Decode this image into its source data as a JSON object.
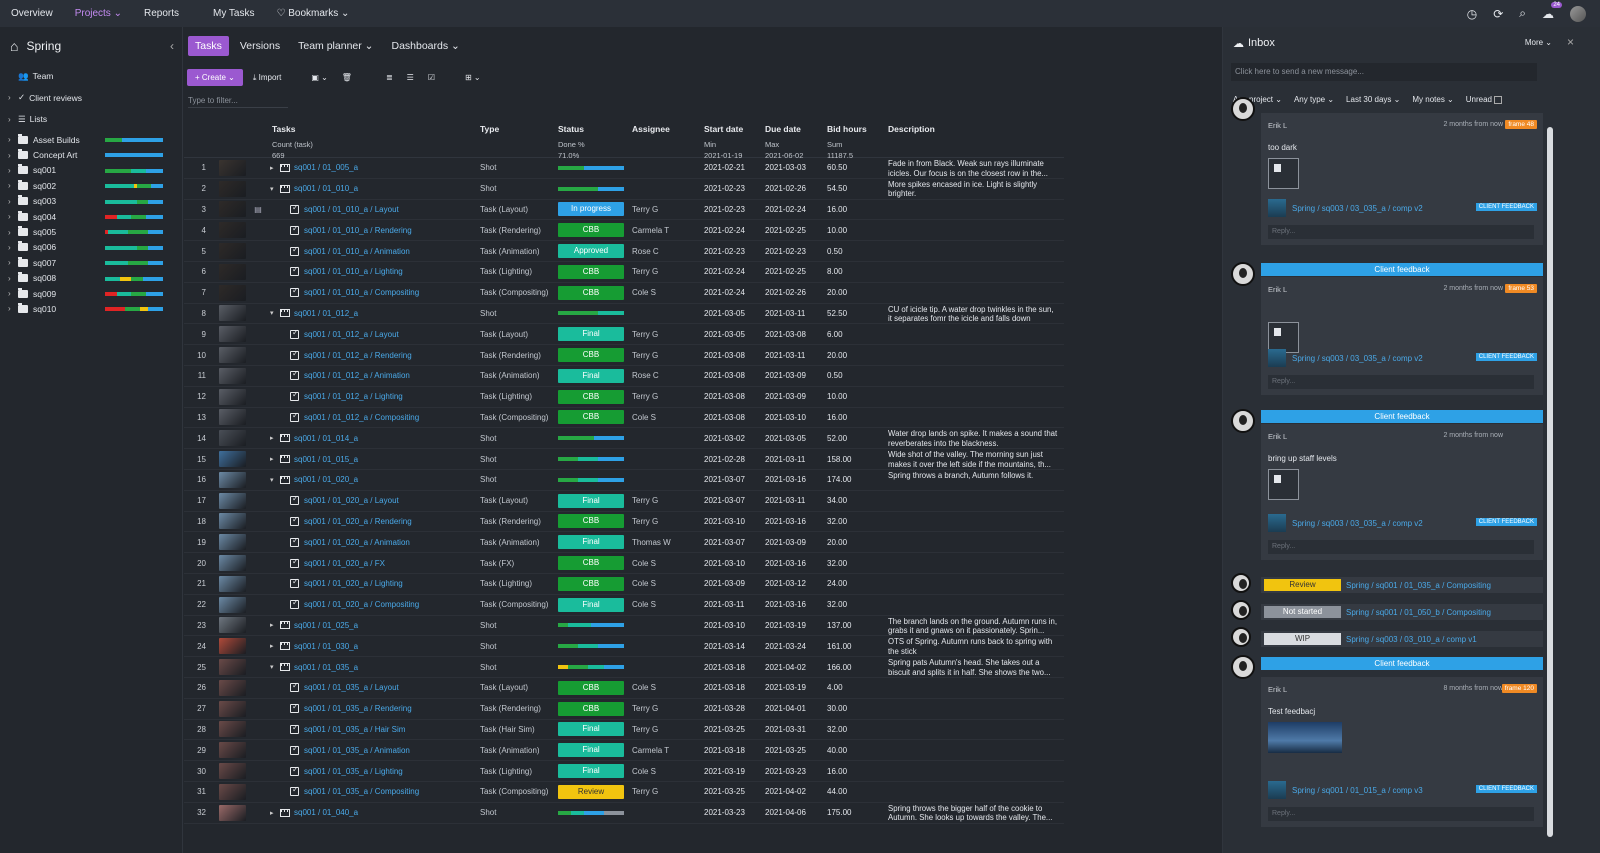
{
  "topnav": {
    "items": [
      "Overview",
      "Projects",
      "Reports",
      "My Tasks",
      "Bookmarks"
    ],
    "notifications_count": "24"
  },
  "sidebar": {
    "project": "Spring",
    "team": "Team",
    "client_reviews": "Client reviews",
    "lists": "Lists",
    "folders": [
      {
        "name": "Asset Builds",
        "bar": [
          [
            "#27a844",
            0.3
          ],
          [
            "#2ea1e6",
            0.7
          ]
        ]
      },
      {
        "name": "Concept Art",
        "bar": [
          [
            "#2ea1e6",
            1.0
          ]
        ]
      },
      {
        "name": "sq001",
        "bar": [
          [
            "#27a844",
            0.45
          ],
          [
            "#1abc9c",
            0.25
          ],
          [
            "#2ea1e6",
            0.3
          ]
        ]
      },
      {
        "name": "sq002",
        "bar": [
          [
            "#1abc9c",
            0.5
          ],
          [
            "#f1c40f",
            0.05
          ],
          [
            "#27a844",
            0.25
          ],
          [
            "#2ea1e6",
            0.2
          ]
        ]
      },
      {
        "name": "sq003",
        "bar": [
          [
            "#1abc9c",
            0.55
          ],
          [
            "#27a844",
            0.2
          ],
          [
            "#2ea1e6",
            0.25
          ]
        ]
      },
      {
        "name": "sq004",
        "bar": [
          [
            "#e02424",
            0.2
          ],
          [
            "#1abc9c",
            0.25
          ],
          [
            "#27a844",
            0.25
          ],
          [
            "#2ea1e6",
            0.3
          ]
        ]
      },
      {
        "name": "sq005",
        "bar": [
          [
            "#e02424",
            0.05
          ],
          [
            "#1abc9c",
            0.35
          ],
          [
            "#27a844",
            0.35
          ],
          [
            "#2ea1e6",
            0.25
          ]
        ]
      },
      {
        "name": "sq006",
        "bar": [
          [
            "#1abc9c",
            0.55
          ],
          [
            "#27a844",
            0.2
          ],
          [
            "#2ea1e6",
            0.25
          ]
        ]
      },
      {
        "name": "sq007",
        "bar": [
          [
            "#1abc9c",
            0.4
          ],
          [
            "#27a844",
            0.35
          ],
          [
            "#2ea1e6",
            0.25
          ]
        ]
      },
      {
        "name": "sq008",
        "bar": [
          [
            "#1abc9c",
            0.25
          ],
          [
            "#f1c40f",
            0.2
          ],
          [
            "#27a844",
            0.2
          ],
          [
            "#2ea1e6",
            0.35
          ]
        ]
      },
      {
        "name": "sq009",
        "bar": [
          [
            "#e02424",
            0.2
          ],
          [
            "#1abc9c",
            0.25
          ],
          [
            "#27a844",
            0.25
          ],
          [
            "#2ea1e6",
            0.3
          ]
        ]
      },
      {
        "name": "sq010",
        "bar": [
          [
            "#e02424",
            0.35
          ],
          [
            "#27a844",
            0.25
          ],
          [
            "#f1c40f",
            0.15
          ],
          [
            "#2ea1e6",
            0.25
          ]
        ]
      }
    ]
  },
  "tabs": [
    "Tasks",
    "Versions",
    "Team planner",
    "Dashboards"
  ],
  "toolbar": {
    "create": "Create",
    "import": "Import",
    "filter_placeholder": "Type to filter..."
  },
  "grid": {
    "headers": {
      "tasks": "Tasks",
      "type": "Type",
      "status": "Status",
      "assignee": "Assignee",
      "start": "Start date",
      "due": "Due date",
      "bid": "Bid hours",
      "desc": "Description"
    },
    "summary": {
      "tasks_label": "Count (task)",
      "tasks_value": "669",
      "status_label": "Done %",
      "status_value": "71.0%",
      "start_label": "Min",
      "start_value": "2021-01-19",
      "due_label": "Max",
      "due_value": "2021-06-02",
      "bid_label": "Sum",
      "bid_value": "11187.5"
    },
    "rows": [
      {
        "n": "1",
        "kind": "shot",
        "exp": "▸",
        "name": "sq001 / 01_005_a",
        "type": "Shot",
        "prog": [
          [
            "#27a844",
            0.4
          ],
          [
            "#2ea1e6",
            0.6
          ]
        ],
        "start": "2021-02-21",
        "due": "2021-03-03",
        "bid": "60.50",
        "desc": "Fade in from Black. Weak sun rays illuminate icicles. Our focus is on the closest row in the...",
        "thumb": "#3a3430"
      },
      {
        "n": "2",
        "kind": "shot",
        "exp": "▾",
        "name": "sq001 / 01_010_a",
        "type": "Shot",
        "prog": [
          [
            "#27a844",
            0.6
          ],
          [
            "#2ea1e6",
            0.4
          ]
        ],
        "start": "2021-02-23",
        "due": "2021-02-26",
        "bid": "54.50",
        "desc": "More spikes encased in ice. Light is slightly brighter.",
        "thumb": "#2e2a28"
      },
      {
        "n": "3",
        "kind": "task",
        "name": "sq001 / 01_010_a / Layout",
        "type": "Task (Layout)",
        "status": "In progress",
        "scolor": "#2ea1e6",
        "assignee": "Terry G",
        "start": "2021-02-23",
        "due": "2021-02-24",
        "bid": "16.00",
        "desc": "",
        "thumb": "#2e2a28",
        "cmt": "▣"
      },
      {
        "n": "4",
        "kind": "task",
        "name": "sq001 / 01_010_a / Rendering",
        "type": "Task (Rendering)",
        "status": "CBB",
        "scolor": "#169c33",
        "assignee": "Carmela T",
        "start": "2021-02-24",
        "due": "2021-02-25",
        "bid": "10.00",
        "desc": "",
        "thumb": "#2e2a28"
      },
      {
        "n": "5",
        "kind": "task",
        "name": "sq001 / 01_010_a / Animation",
        "type": "Task (Animation)",
        "status": "Approved",
        "scolor": "#1abc9c",
        "assignee": "Rose C",
        "start": "2021-02-23",
        "due": "2021-02-23",
        "bid": "0.50",
        "desc": "",
        "thumb": "#2e2a28"
      },
      {
        "n": "6",
        "kind": "task",
        "name": "sq001 / 01_010_a / Lighting",
        "type": "Task (Lighting)",
        "status": "CBB",
        "scolor": "#169c33",
        "assignee": "Terry G",
        "start": "2021-02-24",
        "due": "2021-02-25",
        "bid": "8.00",
        "desc": "",
        "thumb": "#2e2a28"
      },
      {
        "n": "7",
        "kind": "task",
        "name": "sq001 / 01_010_a / Compositing",
        "type": "Task (Compositing)",
        "status": "CBB",
        "scolor": "#169c33",
        "assignee": "Cole S",
        "start": "2021-02-24",
        "due": "2021-02-26",
        "bid": "20.00",
        "desc": "",
        "thumb": "#2e2a28"
      },
      {
        "n": "8",
        "kind": "shot",
        "exp": "▾",
        "name": "sq001 / 01_012_a",
        "type": "Shot",
        "prog": [
          [
            "#27a844",
            0.6
          ],
          [
            "#1abc9c",
            0.4
          ]
        ],
        "start": "2021-03-05",
        "due": "2021-03-11",
        "bid": "52.50",
        "desc": "CU of icicle tip. A water drop twinkles in the sun, it separates fomr the icicle and falls down",
        "thumb": "#5a5e66"
      },
      {
        "n": "9",
        "kind": "task",
        "name": "sq001 / 01_012_a / Layout",
        "type": "Task (Layout)",
        "status": "Final",
        "scolor": "#1abc9c",
        "assignee": "Terry G",
        "start": "2021-03-05",
        "due": "2021-03-08",
        "bid": "6.00",
        "desc": "",
        "thumb": "#5a5e66"
      },
      {
        "n": "10",
        "kind": "task",
        "name": "sq001 / 01_012_a / Rendering",
        "type": "Task (Rendering)",
        "status": "CBB",
        "scolor": "#169c33",
        "assignee": "Terry G",
        "start": "2021-03-08",
        "due": "2021-03-11",
        "bid": "20.00",
        "desc": "",
        "thumb": "#5a5e66"
      },
      {
        "n": "11",
        "kind": "task",
        "name": "sq001 / 01_012_a / Animation",
        "type": "Task (Animation)",
        "status": "Final",
        "scolor": "#1abc9c",
        "assignee": "Rose C",
        "start": "2021-03-08",
        "due": "2021-03-09",
        "bid": "0.50",
        "desc": "",
        "thumb": "#5a5e66"
      },
      {
        "n": "12",
        "kind": "task",
        "name": "sq001 / 01_012_a / Lighting",
        "type": "Task (Lighting)",
        "status": "CBB",
        "scolor": "#169c33",
        "assignee": "Terry G",
        "start": "2021-03-08",
        "due": "2021-03-09",
        "bid": "10.00",
        "desc": "",
        "thumb": "#5a5e66"
      },
      {
        "n": "13",
        "kind": "task",
        "name": "sq001 / 01_012_a / Compositing",
        "type": "Task (Compositing)",
        "status": "CBB",
        "scolor": "#169c33",
        "assignee": "Cole S",
        "start": "2021-03-08",
        "due": "2021-03-10",
        "bid": "16.00",
        "desc": "",
        "thumb": "#5a5e66"
      },
      {
        "n": "14",
        "kind": "shot",
        "exp": "▸",
        "name": "sq001 / 01_014_a",
        "type": "Shot",
        "prog": [
          [
            "#27a844",
            0.55
          ],
          [
            "#2ea1e6",
            0.45
          ]
        ],
        "start": "2021-03-02",
        "due": "2021-03-05",
        "bid": "52.00",
        "desc": "Water drop lands on spike. It makes a sound that reverberates into the blackness.",
        "thumb": "#4a4f57"
      },
      {
        "n": "15",
        "kind": "shot",
        "exp": "▸",
        "name": "sq001 / 01_015_a",
        "type": "Shot",
        "prog": [
          [
            "#27a844",
            0.3
          ],
          [
            "#1abc9c",
            0.3
          ],
          [
            "#2ea1e6",
            0.4
          ]
        ],
        "start": "2021-02-28",
        "due": "2021-03-11",
        "bid": "158.00",
        "desc": "Wide shot of the valley. The morning sun just makes it over the left side if the mountains, th...",
        "thumb": "#3f6f9c"
      },
      {
        "n": "16",
        "kind": "shot",
        "exp": "▾",
        "name": "sq001 / 01_020_a",
        "type": "Shot",
        "prog": [
          [
            "#27a844",
            0.3
          ],
          [
            "#1abc9c",
            0.3
          ],
          [
            "#2ea1e6",
            0.4
          ]
        ],
        "start": "2021-03-07",
        "due": "2021-03-16",
        "bid": "174.00",
        "desc": "Spring throws a branch, Autumn follows it.",
        "thumb": "#6c8aa5"
      },
      {
        "n": "17",
        "kind": "task",
        "name": "sq001 / 01_020_a / Layout",
        "type": "Task (Layout)",
        "status": "Final",
        "scolor": "#1abc9c",
        "assignee": "Terry G",
        "start": "2021-03-07",
        "due": "2021-03-11",
        "bid": "34.00",
        "desc": "",
        "thumb": "#6c8aa5"
      },
      {
        "n": "18",
        "kind": "task",
        "name": "sq001 / 01_020_a / Rendering",
        "type": "Task (Rendering)",
        "status": "CBB",
        "scolor": "#169c33",
        "assignee": "Terry G",
        "start": "2021-03-10",
        "due": "2021-03-16",
        "bid": "32.00",
        "desc": "",
        "thumb": "#6c8aa5"
      },
      {
        "n": "19",
        "kind": "task",
        "name": "sq001 / 01_020_a / Animation",
        "type": "Task (Animation)",
        "status": "Final",
        "scolor": "#1abc9c",
        "assignee": "Thomas W",
        "start": "2021-03-07",
        "due": "2021-03-09",
        "bid": "20.00",
        "desc": "",
        "thumb": "#6c8aa5"
      },
      {
        "n": "20",
        "kind": "task",
        "name": "sq001 / 01_020_a / FX",
        "type": "Task (FX)",
        "status": "CBB",
        "scolor": "#169c33",
        "assignee": "Cole S",
        "start": "2021-03-10",
        "due": "2021-03-16",
        "bid": "32.00",
        "desc": "",
        "thumb": "#6c8aa5"
      },
      {
        "n": "21",
        "kind": "task",
        "name": "sq001 / 01_020_a / Lighting",
        "type": "Task (Lighting)",
        "status": "CBB",
        "scolor": "#169c33",
        "assignee": "Cole S",
        "start": "2021-03-09",
        "due": "2021-03-12",
        "bid": "24.00",
        "desc": "",
        "thumb": "#6c8aa5"
      },
      {
        "n": "22",
        "kind": "task",
        "name": "sq001 / 01_020_a / Compositing",
        "type": "Task (Compositing)",
        "status": "Final",
        "scolor": "#1abc9c",
        "assignee": "Cole S",
        "start": "2021-03-11",
        "due": "2021-03-16",
        "bid": "32.00",
        "desc": "",
        "thumb": "#6c8aa5"
      },
      {
        "n": "23",
        "kind": "shot",
        "exp": "▸",
        "name": "sq001 / 01_025_a",
        "type": "Shot",
        "prog": [
          [
            "#27a844",
            0.15
          ],
          [
            "#1abc9c",
            0.35
          ],
          [
            "#2ea1e6",
            0.5
          ]
        ],
        "start": "2021-03-10",
        "due": "2021-03-19",
        "bid": "137.00",
        "desc": "The branch lands on the ground. Autumn runs in, grabs it and gnaws on it passionately. Sprin...",
        "thumb": "#6f7780"
      },
      {
        "n": "24",
        "kind": "shot",
        "exp": "▸",
        "name": "sq001 / 01_030_a",
        "type": "Shot",
        "prog": [
          [
            "#27a844",
            0.3
          ],
          [
            "#1abc9c",
            0.3
          ],
          [
            "#2ea1e6",
            0.4
          ]
        ],
        "start": "2021-03-14",
        "due": "2021-03-24",
        "bid": "161.00",
        "desc": "OTS of Spring. Autumn runs back to spring with the stick",
        "thumb": "#b04a3a"
      },
      {
        "n": "25",
        "kind": "shot",
        "exp": "▾",
        "name": "sq001 / 01_035_a",
        "type": "Shot",
        "prog": [
          [
            "#f1c40f",
            0.15
          ],
          [
            "#27a844",
            0.3
          ],
          [
            "#1abc9c",
            0.25
          ],
          [
            "#2ea1e6",
            0.3
          ]
        ],
        "start": "2021-03-18",
        "due": "2021-04-02",
        "bid": "166.00",
        "desc": "Spring pats Autumn's head. She takes out a biscuit and splits it in half. She shows the two...",
        "thumb": "#6a4a48"
      },
      {
        "n": "26",
        "kind": "task",
        "name": "sq001 / 01_035_a / Layout",
        "type": "Task (Layout)",
        "status": "CBB",
        "scolor": "#169c33",
        "assignee": "Cole S",
        "start": "2021-03-18",
        "due": "2021-03-19",
        "bid": "4.00",
        "desc": "",
        "thumb": "#6a4a48"
      },
      {
        "n": "27",
        "kind": "task",
        "name": "sq001 / 01_035_a / Rendering",
        "type": "Task (Rendering)",
        "status": "CBB",
        "scolor": "#169c33",
        "assignee": "Terry G",
        "start": "2021-03-28",
        "due": "2021-04-01",
        "bid": "30.00",
        "desc": "",
        "thumb": "#6a4a48"
      },
      {
        "n": "28",
        "kind": "task",
        "name": "sq001 / 01_035_a / Hair Sim",
        "type": "Task (Hair Sim)",
        "status": "Final",
        "scolor": "#1abc9c",
        "assignee": "Terry G",
        "start": "2021-03-25",
        "due": "2021-03-31",
        "bid": "32.00",
        "desc": "",
        "thumb": "#6a4a48"
      },
      {
        "n": "29",
        "kind": "task",
        "name": "sq001 / 01_035_a / Animation",
        "type": "Task (Animation)",
        "status": "Final",
        "scolor": "#1abc9c",
        "assignee": "Carmela T",
        "start": "2021-03-18",
        "due": "2021-03-25",
        "bid": "40.00",
        "desc": "",
        "thumb": "#6a4a48"
      },
      {
        "n": "30",
        "kind": "task",
        "name": "sq001 / 01_035_a / Lighting",
        "type": "Task (Lighting)",
        "status": "Final",
        "scolor": "#1abc9c",
        "assignee": "Cole S",
        "start": "2021-03-19",
        "due": "2021-03-23",
        "bid": "16.00",
        "desc": "",
        "thumb": "#6a4a48"
      },
      {
        "n": "31",
        "kind": "task",
        "name": "sq001 / 01_035_a / Compositing",
        "type": "Task (Compositing)",
        "status": "Review",
        "scolor": "#f1c40f",
        "stext": "#333",
        "assignee": "Terry G",
        "start": "2021-03-25",
        "due": "2021-04-02",
        "bid": "44.00",
        "desc": "",
        "thumb": "#6a4a48"
      },
      {
        "n": "32",
        "kind": "shot",
        "exp": "▸",
        "name": "sq001 / 01_040_a",
        "type": "Shot",
        "prog": [
          [
            "#27a844",
            0.2
          ],
          [
            "#1abc9c",
            0.2
          ],
          [
            "#2ea1e6",
            0.3
          ],
          [
            "#8c929b",
            0.3
          ]
        ],
        "start": "2021-03-23",
        "due": "2021-04-06",
        "bid": "175.00",
        "desc": "Spring throws the bigger half of the cookie to Autumn. She looks up towards the valley. The...",
        "thumb": "#9a6a68"
      }
    ]
  },
  "inbox": {
    "title": "Inbox",
    "more": "More",
    "input_placeholder": "Click here to send a new message...",
    "filters": [
      "Any project",
      "Any type",
      "Last 30 days",
      "My notes",
      "Unread"
    ],
    "reply_placeholder": "Reply...",
    "banner": "Client feedback",
    "cards": [
      {
        "author": "Erik L",
        "time": "2 months from now",
        "frame": "frame 48",
        "text": "too dark",
        "link": "Spring / sq003 / 03_035_a / comp v2",
        "tag": "CLIENT FEEDBACK"
      },
      {
        "author": "Erik L",
        "time": "2 months from now",
        "frame": "frame 53",
        "text": "",
        "link": "Spring / sq003 / 03_035_a / comp v2",
        "tag": "CLIENT FEEDBACK"
      },
      {
        "author": "Erik L",
        "time": "2 months from now",
        "frame": "",
        "text": "bring up staff levels",
        "link": "Spring / sq003 / 03_035_a / comp v2",
        "tag": "CLIENT FEEDBACK"
      },
      {
        "author": "Erik L",
        "time": "8 months from now",
        "frame": "frame 120",
        "text": "Test feedbacj",
        "link": "Spring / sq001 / 01_015_a / comp v3",
        "tag": "CLIENT FEEDBACK"
      }
    ],
    "notifs": [
      {
        "status": "Review",
        "color": "#f1c40f",
        "text_color": "#333",
        "link": "Spring / sq001 / 01_035_a / Compositing"
      },
      {
        "status": "Not started",
        "color": "#8c929b",
        "text_color": "#fff",
        "link": "Spring / sq001 / 01_050_b / Compositing"
      },
      {
        "status": "WIP",
        "color": "#d9dce0",
        "text_color": "#333",
        "link": "Spring / sq003 / 03_010_a / comp v1"
      }
    ]
  }
}
